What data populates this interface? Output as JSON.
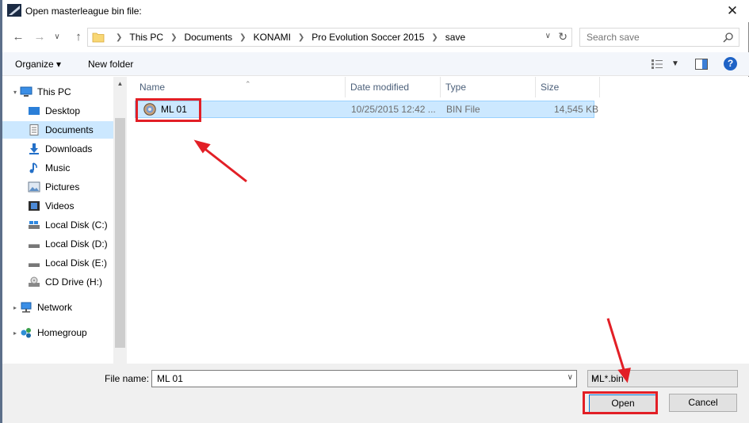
{
  "window": {
    "title": "Open masterleague bin file:",
    "close_label": "✕"
  },
  "address": {
    "breadcrumbs": [
      "This PC",
      "Documents",
      "KONAMI",
      "Pro Evolution Soccer 2015",
      "save"
    ],
    "search_placeholder": "Search save"
  },
  "toolbar": {
    "organize_label": "Organize ▾",
    "new_folder_label": "New folder",
    "help_label": "?"
  },
  "sidebar": {
    "items": [
      {
        "label": "This PC",
        "icon": "pc-icon"
      },
      {
        "label": "Desktop",
        "icon": "desktop-icon"
      },
      {
        "label": "Documents",
        "icon": "documents-icon",
        "selected": true
      },
      {
        "label": "Downloads",
        "icon": "downloads-icon"
      },
      {
        "label": "Music",
        "icon": "music-icon"
      },
      {
        "label": "Pictures",
        "icon": "pictures-icon"
      },
      {
        "label": "Videos",
        "icon": "videos-icon"
      },
      {
        "label": "Local Disk (C:)",
        "icon": "disk-icon"
      },
      {
        "label": "Local Disk (D:)",
        "icon": "disk-icon"
      },
      {
        "label": "Local Disk (E:)",
        "icon": "disk-icon"
      },
      {
        "label": "CD Drive (H:)",
        "icon": "cd-icon"
      },
      {
        "label": "Network",
        "icon": "network-icon"
      },
      {
        "label": "Homegroup",
        "icon": "homegroup-icon"
      }
    ]
  },
  "filelist": {
    "columns": [
      "Name",
      "Date modified",
      "Type",
      "Size"
    ],
    "rows": [
      {
        "name": "ML 01",
        "date": "10/25/2015 12:42 ...",
        "type": "BIN File",
        "size": "14,545 KB"
      }
    ]
  },
  "bottom": {
    "filename_label": "File name:",
    "filename_value": "ML 01",
    "filetype_value": "ML*.bin",
    "open_label": "Open",
    "cancel_label": "Cancel"
  },
  "colors": {
    "annotation_red": "#e21f26",
    "selection_blue": "#cce8ff",
    "accent_blue": "#0078d7"
  }
}
